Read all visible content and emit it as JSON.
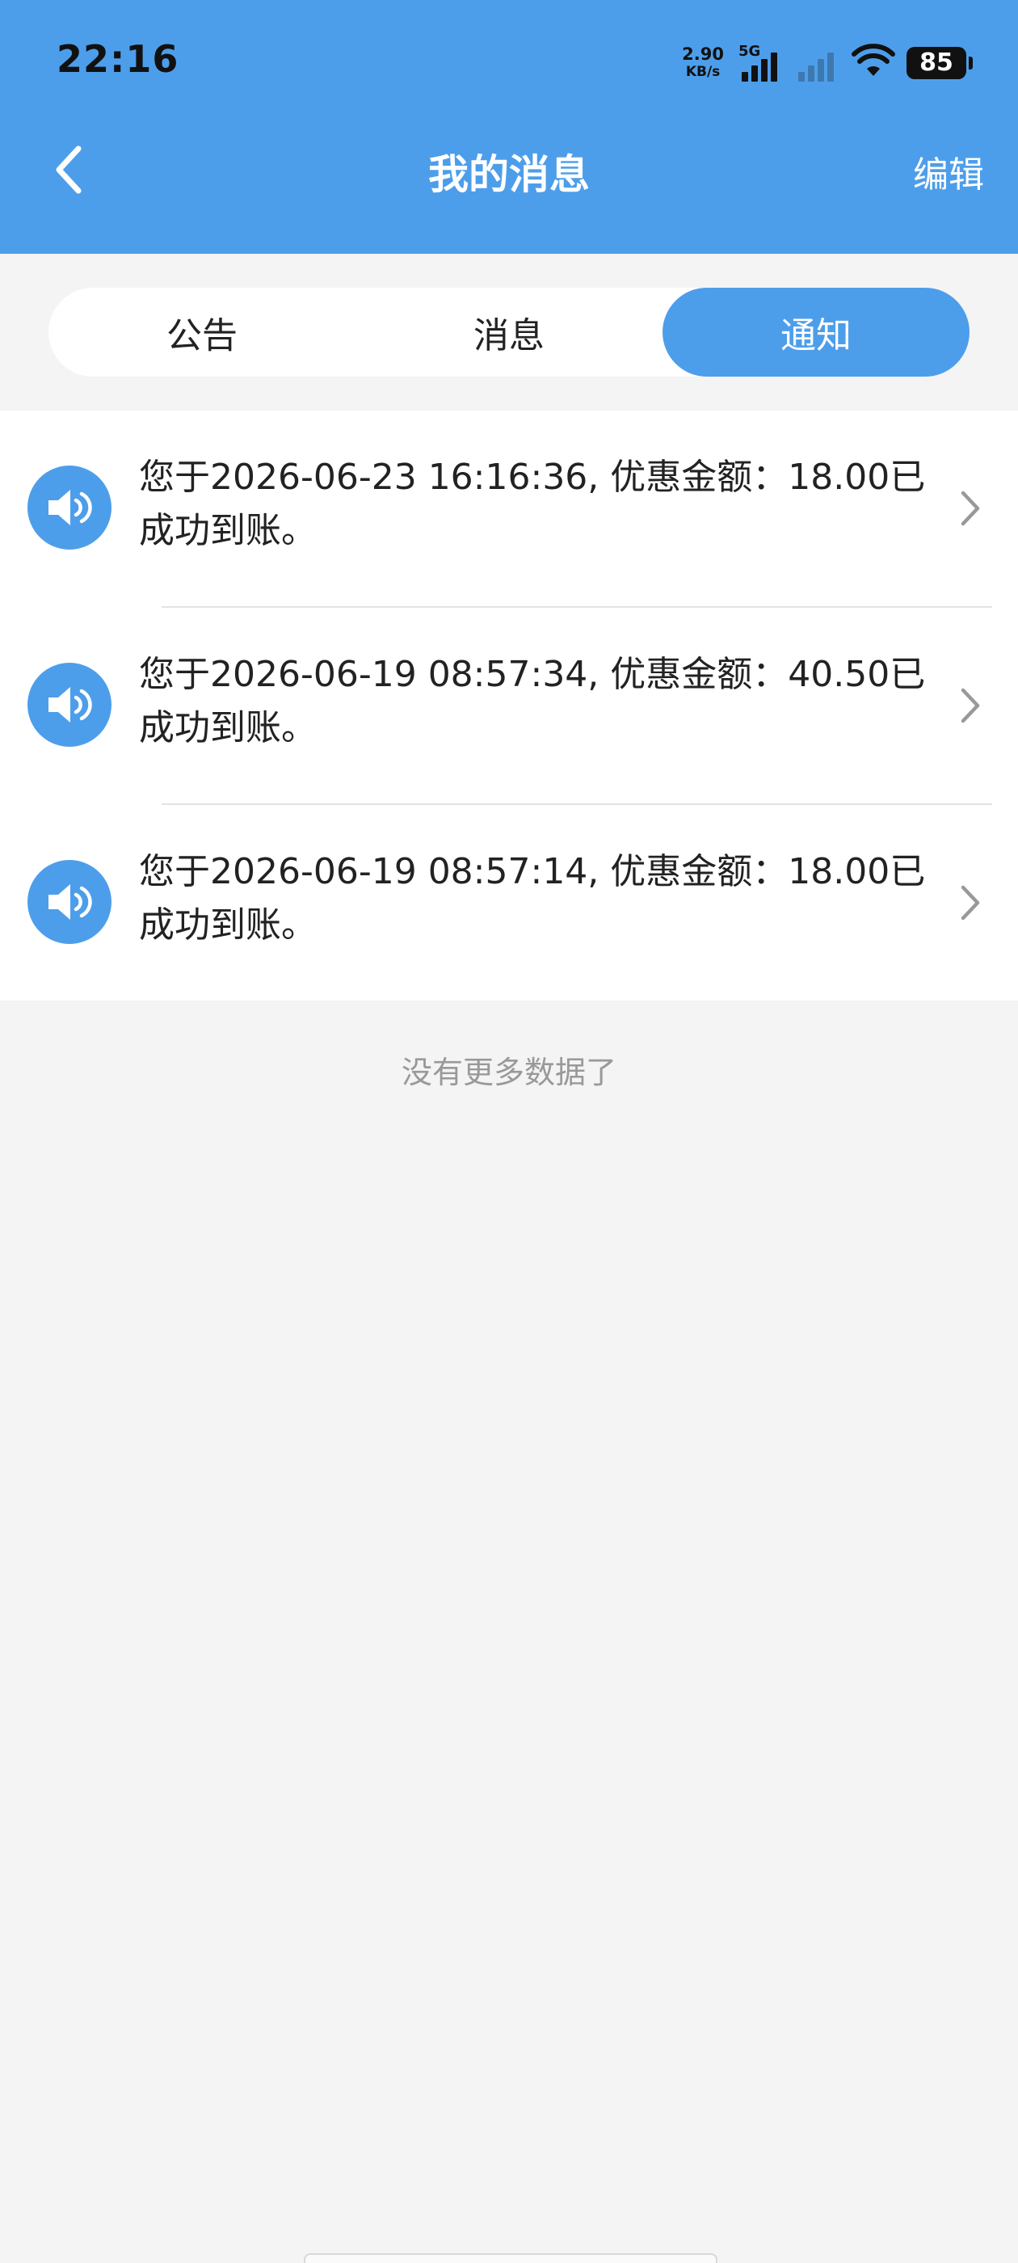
{
  "status_bar": {
    "time": "22:16",
    "net_speed": "2.90",
    "net_unit": "KB/s",
    "network_type": "5G",
    "battery": "85"
  },
  "nav": {
    "title": "我的消息",
    "edit_label": "编辑",
    "back_icon": "chevron-left-icon"
  },
  "tabs": [
    {
      "label": "公告",
      "active": false
    },
    {
      "label": "消息",
      "active": false
    },
    {
      "label": "通知",
      "active": true
    }
  ],
  "notices": [
    {
      "text": "您于2026-06-23 16:16:36, 优惠金额：18.00已成功到账。",
      "icon": "speaker-icon"
    },
    {
      "text": "您于2026-06-19 08:57:34, 优惠金额：40.50已成功到账。",
      "icon": "speaker-icon"
    },
    {
      "text": "您于2026-06-19 08:57:14, 优惠金额：18.00已成功到账。",
      "icon": "speaker-icon"
    }
  ],
  "footer": {
    "no_more": "没有更多数据了"
  },
  "colors": {
    "primary": "#4d9eea",
    "background": "#f4f4f4"
  }
}
